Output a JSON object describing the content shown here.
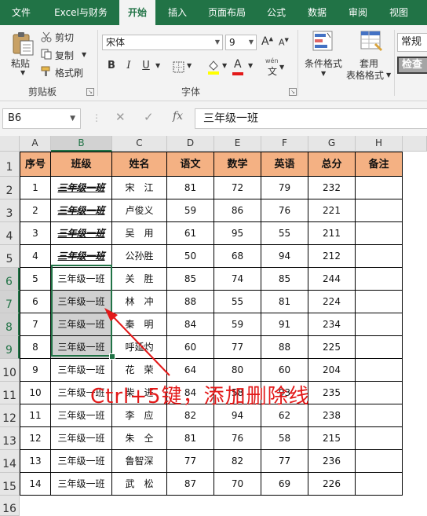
{
  "ribbon_tabs": [
    {
      "label": "文件"
    },
    {
      "label": "Excel与财务"
    },
    {
      "label": "开始"
    },
    {
      "label": "插入"
    },
    {
      "label": "页面布局"
    },
    {
      "label": "公式"
    },
    {
      "label": "数据"
    },
    {
      "label": "审阅"
    },
    {
      "label": "视图"
    }
  ],
  "clipboard": {
    "paste": "粘贴",
    "cut": "剪切",
    "copy": "复制",
    "format_painter": "格式刷",
    "group": "剪贴板"
  },
  "font": {
    "name": "宋体",
    "size": "9",
    "group": "字体",
    "bold": "B",
    "italic": "I",
    "underline": "U",
    "grow": "A",
    "shrink": "A",
    "wen": "wén"
  },
  "styles": {
    "conditional": "条件格式",
    "table_line1": "套用",
    "table_line2": "表格格式"
  },
  "number": {
    "format": "常规",
    "check": "检查"
  },
  "name_box": "B6",
  "formula_bar": {
    "cancel": "✕",
    "enter": "✓",
    "fx": "fx",
    "value": "三年级一班"
  },
  "columns": [
    "A",
    "B",
    "C",
    "D",
    "E",
    "F",
    "G",
    "H"
  ],
  "rows": [
    "1",
    "2",
    "3",
    "4",
    "5",
    "6",
    "7",
    "8",
    "9",
    "10",
    "11",
    "12",
    "13",
    "14",
    "15",
    "16"
  ],
  "table": {
    "headers": [
      "序号",
      "班级",
      "姓名",
      "语文",
      "数学",
      "英语",
      "总分",
      "备注"
    ],
    "rows": [
      [
        "1",
        "三年级一班",
        "宋　江",
        "81",
        "72",
        "79",
        "232",
        ""
      ],
      [
        "2",
        "三年级一班",
        "卢俊义",
        "59",
        "86",
        "76",
        "221",
        ""
      ],
      [
        "3",
        "三年级一班",
        "吴　用",
        "61",
        "95",
        "55",
        "211",
        ""
      ],
      [
        "4",
        "三年级一班",
        "公孙胜",
        "50",
        "68",
        "94",
        "212",
        ""
      ],
      [
        "5",
        "三年级一班",
        "关　胜",
        "85",
        "74",
        "85",
        "244",
        ""
      ],
      [
        "6",
        "三年级一班",
        "林　冲",
        "88",
        "55",
        "81",
        "224",
        ""
      ],
      [
        "7",
        "三年级一班",
        "秦　明",
        "84",
        "59",
        "91",
        "234",
        ""
      ],
      [
        "8",
        "三年级一班",
        "呼延灼",
        "60",
        "77",
        "88",
        "225",
        ""
      ],
      [
        "9",
        "三年级一班",
        "花　荣",
        "64",
        "80",
        "60",
        "204",
        ""
      ],
      [
        "10",
        "三年级一班",
        "柴　进",
        "84",
        "58",
        "93",
        "235",
        ""
      ],
      [
        "11",
        "三年级一班",
        "李　应",
        "82",
        "94",
        "62",
        "238",
        ""
      ],
      [
        "12",
        "三年级一班",
        "朱　仝",
        "81",
        "76",
        "58",
        "215",
        ""
      ],
      [
        "13",
        "三年级一班",
        "鲁智深",
        "77",
        "82",
        "77",
        "236",
        ""
      ],
      [
        "14",
        "三年级一班",
        "武　松",
        "87",
        "70",
        "69",
        "226",
        ""
      ]
    ]
  },
  "annotation": "Ctrl+5键，添加删除线",
  "colors": {
    "ribbon": "#217346",
    "header_fill": "#f4b183",
    "annotation": "#e31919",
    "selection": "#217346"
  }
}
